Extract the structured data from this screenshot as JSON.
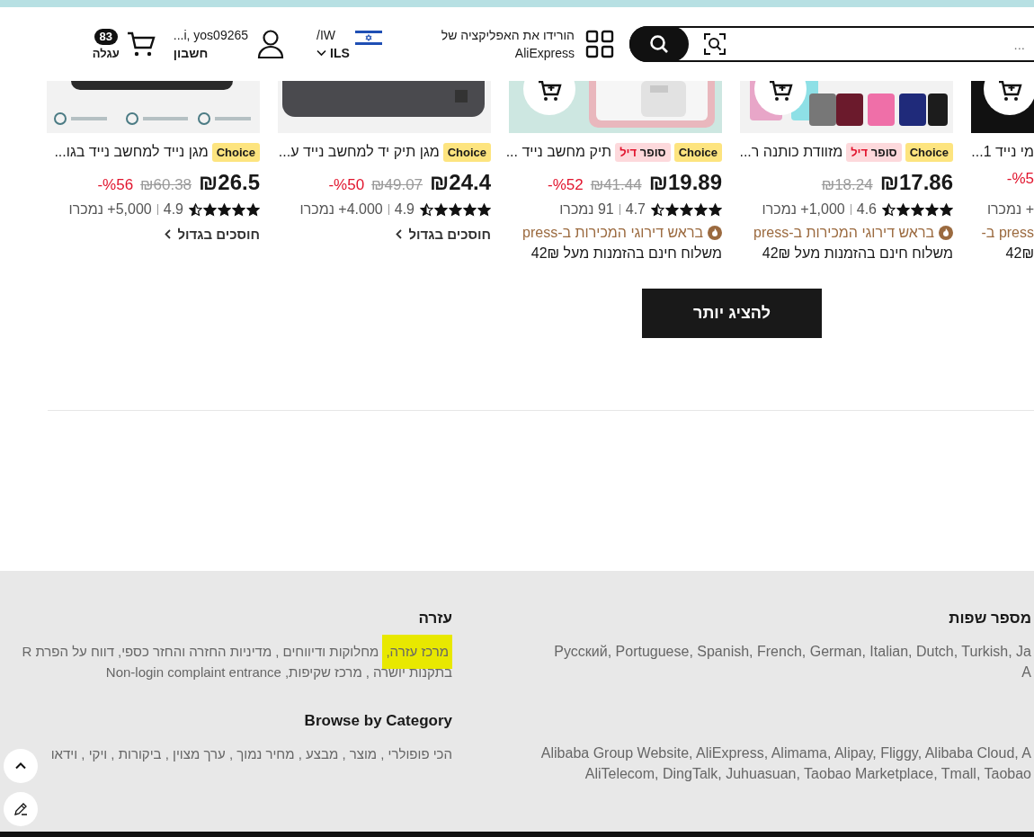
{
  "header": {
    "search": {
      "placeholder": "..."
    },
    "app_promo": {
      "line_1": "הורידו את האפליקציה של",
      "line_2": "AliExpress"
    },
    "region": {
      "language": "/IW",
      "currency": "ILS"
    },
    "account": {
      "user": "...i, yos09265",
      "label": "חשבון"
    },
    "cart": {
      "count": "83",
      "label": "עגלה"
    }
  },
  "products": [
    {
      "kind": "cut-off",
      "cart_button": true,
      "title": "מי נייד 1...",
      "discount": "-%5",
      "sold": "+ נמכרו",
      "bestseller": "press ב-",
      "shipping": "42₪"
    },
    {
      "kind": "full",
      "cart_button": true,
      "title": "מזוודת כותנה ר...",
      "badges": [
        {
          "kind": "choice",
          "text": "Choice"
        },
        {
          "kind": "super-deal",
          "text": "סופר",
          "accent": "דיל"
        }
      ],
      "price": "₪17.86",
      "old_price": "₪18.24",
      "rating": "4.6",
      "stars": 4.5,
      "sold": "1,000+ נמכרו",
      "bestseller": "בראש דירוגי המכירות ב-press",
      "shipping": "משלוח חינם בהזמנות מעל 42₪"
    },
    {
      "kind": "full",
      "cart_button": true,
      "title": "תיק מחשב נייד ...",
      "badges": [
        {
          "kind": "choice",
          "text": "Choice"
        },
        {
          "kind": "super-deal",
          "text": "סופר",
          "accent": "דיל"
        }
      ],
      "price": "₪19.89",
      "old_price": "₪41.44",
      "discount": "-%52",
      "rating": "4.7",
      "stars": 4.5,
      "sold": "91 נמכרו",
      "bestseller": "בראש דירוגי המכירות ב-press",
      "shipping": "משלוח חינם בהזמנות מעל 42₪"
    },
    {
      "kind": "full",
      "cart_button": false,
      "title": "מגן תיק יד למחשב נייד ע...",
      "badges": [
        {
          "kind": "choice",
          "text": "Choice"
        }
      ],
      "price": "₪24.4",
      "old_price": "₪49.07",
      "discount": "-%50",
      "rating": "4.9",
      "stars": 4.5,
      "sold": "4.000+ נמכרו",
      "promo_link": "חוסכים בגדול"
    },
    {
      "kind": "full",
      "cart_button": false,
      "title": "מגן נייד למחשב נייד בגו...",
      "badges": [
        {
          "kind": "choice",
          "text": "Choice"
        }
      ],
      "price": "₪26.5",
      "old_price": "₪60.38",
      "discount": "-%56",
      "rating": "4.9",
      "stars": 4.5,
      "sold": "5,000+ נמכרו",
      "promo_link": "חוסכים בגדול"
    }
  ],
  "show_more": "להציג יותר",
  "footer": {
    "languages": {
      "title": "מספר שפות",
      "lines": [
        "Русский, Portuguese, Spanish, French, German, Italian, Dutch, Turkish, Ja",
        "A"
      ]
    },
    "help": {
      "title": "עזרה",
      "lines": [
        [
          {
            "text": "מרכז עזרה,",
            "highlighted": true
          },
          {
            "text": "מחלוקות ודיווחים ,",
            "highlighted": false
          },
          {
            "text": "מדיניות החזרה והחזר כספי,",
            "highlighted": false
          },
          {
            "text": "דווח על הפרת R",
            "highlighted": false
          }
        ],
        [
          {
            "text": "בתקנות יושרה ,",
            "highlighted": false
          },
          {
            "text": "מרכז שקיפות,",
            "highlighted": false
          },
          {
            "text": "Non-login complaint entrance",
            "highlighted": false
          }
        ]
      ]
    },
    "partners": {
      "lines": [
        "Alibaba Group Website, AliExpress, Alimama, Alipay, Fliggy, Alibaba Cloud, A",
        "AliTelecom, DingTalk, Juhuasuan, Taobao Marketplace, Tmall, Taobao"
      ]
    },
    "browse": {
      "title": "Browse by Category",
      "text": "הכי פופולרי , מוצר , מבצע , מחיר נמוך , ערך מצוין , ביקורות , ויקי , וידאו"
    }
  }
}
